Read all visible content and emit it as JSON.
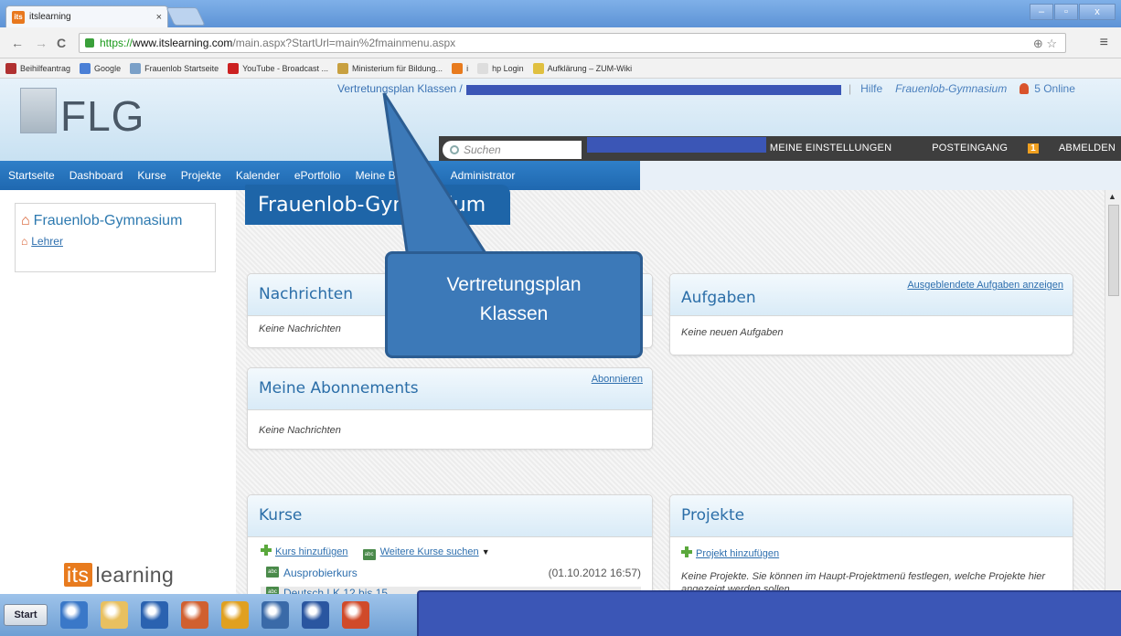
{
  "browser": {
    "tab_title": "itslearning",
    "tab_close": "×",
    "url_https": "https://",
    "url_host": "www.itslearning.com",
    "url_path": "/main.aspx?StartUrl=main%2fmainmenu.aspx",
    "url_icons": "⊕ ☆",
    "menu_icon": "≡",
    "back": "←",
    "forward": "→",
    "reload": "C",
    "win_min": "–",
    "win_max": "▫",
    "win_close": "x"
  },
  "bookmarks": [
    {
      "label": "Beihilfeantrag",
      "color": "#b03030"
    },
    {
      "label": "Google",
      "color": "#4a7fd6"
    },
    {
      "label": "Frauenlob Startseite",
      "color": "#7aa0c8"
    },
    {
      "label": "YouTube - Broadcast ...",
      "color": "#cc2020"
    },
    {
      "label": "Ministerium für Bildung...",
      "color": "#c8a040"
    },
    {
      "label": "i",
      "color": "#e87b1e"
    },
    {
      "label": "hp Login",
      "color": "#dddddd"
    },
    {
      "label": "Aufklärung – ZUM-Wiki",
      "color": "#e0c040"
    }
  ],
  "header": {
    "logo_text": "FLG",
    "breadcrumb": "Vertretungsplan Klassen /",
    "help": "Hilfe",
    "school": "Frauenlob-Gymnasium",
    "online": "5 Online",
    "search_placeholder": "Suchen",
    "settings": "MEINE EINSTELLUNGEN",
    "inbox": "POSTEINGANG",
    "inbox_count": "1",
    "logout": "ABMELDEN"
  },
  "nav": [
    "Startseite",
    "Dashboard",
    "Kurse",
    "Projekte",
    "Kalender",
    "ePortfolio",
    "Meine Bibliothek",
    "Administrator"
  ],
  "left": {
    "title": "Frauenlob-Gymnasium",
    "sub": "Lehrer",
    "logo_its": "its",
    "logo_learning": "learning"
  },
  "main": {
    "page_title": "Frauenlob-Gymnasium",
    "news": {
      "title": "Nachrichten",
      "empty": "Keine Nachrichten"
    },
    "tasks": {
      "title": "Aufgaben",
      "link": "Ausgeblendete Aufgaben anzeigen",
      "empty": "Keine neuen Aufgaben"
    },
    "subs": {
      "title": "Meine Abonnements",
      "link": "Abonnieren",
      "empty": "Keine Nachrichten"
    },
    "courses": {
      "title": "Kurse",
      "add": "Kurs hinzufügen",
      "more": "Weitere Kurse suchen",
      "items": [
        {
          "name": "Ausprobierkurs",
          "date": "(01.10.2012 16:57)"
        },
        {
          "name": "Deutsch LK 12 bis 15",
          "date": ""
        }
      ]
    },
    "projects": {
      "title": "Projekte",
      "add": "Projekt hinzufügen",
      "empty": "Keine Projekte. Sie können im Haupt-Projektmenü festlegen, welche Projekte hier angezeigt werden sollen."
    }
  },
  "callout": {
    "line1": "Vertretungsplan",
    "line2": "Klassen"
  },
  "taskbar": {
    "start": "Start",
    "icons": [
      {
        "name": "ie-icon",
        "color": "#3a78c8"
      },
      {
        "name": "explorer-icon",
        "color": "#e8c060"
      },
      {
        "name": "outlook-icon",
        "color": "#2a62b0"
      },
      {
        "name": "paint-icon",
        "color": "#d06030"
      },
      {
        "name": "users-icon",
        "color": "#e0a020"
      },
      {
        "name": "thunderbird-icon",
        "color": "#3a6aa8"
      },
      {
        "name": "word-icon",
        "color": "#2a56a0"
      },
      {
        "name": "chrome-icon",
        "color": "#d04a2a"
      }
    ]
  }
}
